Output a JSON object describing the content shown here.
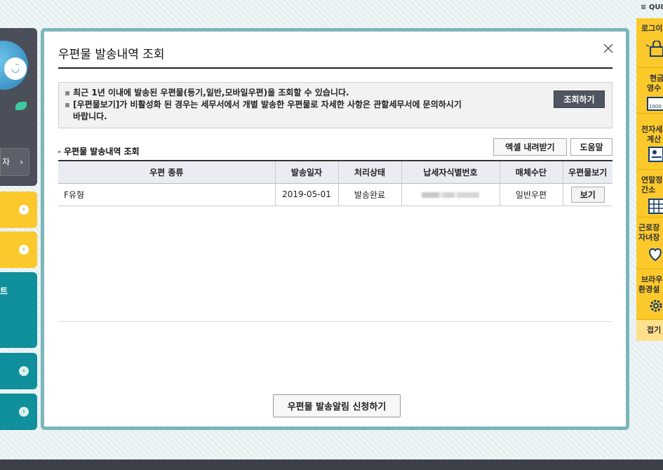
{
  "modal": {
    "title": "우편물 발송내역 조회",
    "notice": {
      "line1": "최근 1년 이내에 발송된 우편물(등기,일반,모바일우편)을 조회할 수 있습니다.",
      "line2": "[우편물보기]가 비활성화 된 경우는 세무서에서 개별 발송한 우편물로 자세한 사항은 관할세무서에 문의하시기",
      "line3": "바랍니다.",
      "button": "조회하기"
    },
    "section_title": "우편물 발송내역 조회",
    "excel_button": "엑셀 내려받기",
    "help_button": "도움말",
    "table": {
      "headers": [
        "우편 종류",
        "발송일자",
        "처리상태",
        "납세자식별번호",
        "매체수단",
        "우편물보기"
      ],
      "rows": [
        {
          "type": "F유형",
          "date": "2019-05-01",
          "status": "발송완료",
          "medium": "일반우편",
          "view": "보기"
        }
      ]
    },
    "notify_button": "우편물 발송알림 신청하기"
  },
  "left": {
    "btn_text": "자",
    "teal_text": "트"
  },
  "quick": {
    "header": "≡ QUI",
    "items": [
      {
        "label": "로그이",
        "icon": "login-icon"
      },
      {
        "label1": "현금",
        "label2": "영수",
        "icon": "receipt-icon"
      },
      {
        "label1": "전자세",
        "label2": "계산",
        "icon": "invoice-icon"
      },
      {
        "label1": "연말정",
        "label2": "간소",
        "icon": "calculator-icon"
      },
      {
        "label1": "근로장",
        "label2": "자녀장",
        "icon": "heart-hands-icon"
      },
      {
        "label1": "브라우",
        "label2": "환경설",
        "icon": "gear-icon"
      }
    ],
    "close": "접기"
  }
}
